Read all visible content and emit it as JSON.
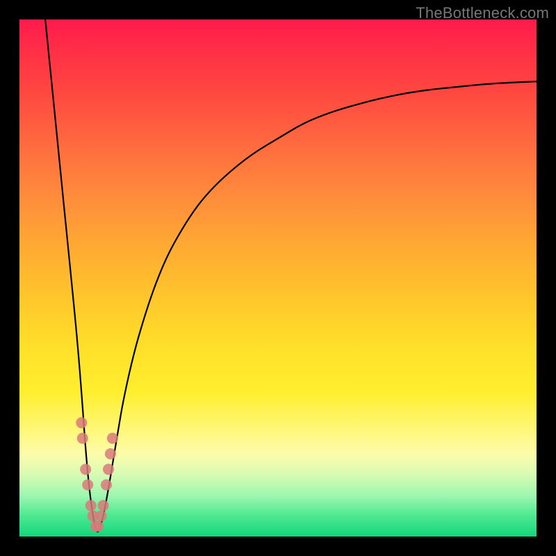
{
  "watermark": "TheBottleneck.com",
  "chart_data": {
    "type": "line",
    "title": "",
    "xlabel": "",
    "ylabel": "",
    "xlim": [
      0,
      100
    ],
    "ylim": [
      0,
      100
    ],
    "legend": false,
    "grid": false,
    "series": [
      {
        "name": "bottleneck-curve",
        "x": [
          5,
          6,
          7,
          8,
          9,
          10,
          11,
          12,
          13,
          14,
          15,
          16,
          17,
          18,
          19,
          20,
          22,
          24,
          26,
          28,
          30,
          33,
          36,
          40,
          45,
          50,
          55,
          60,
          65,
          70,
          75,
          80,
          85,
          90,
          95,
          100
        ],
        "values": [
          100,
          90,
          80,
          70,
          60,
          50,
          40,
          28,
          14,
          5,
          0,
          3,
          8,
          14,
          20,
          26,
          35,
          42,
          48,
          53,
          57,
          62,
          66,
          70,
          74,
          77,
          80,
          82,
          83.5,
          84.8,
          85.8,
          86.5,
          87,
          87.5,
          87.8,
          88
        ]
      }
    ],
    "markers": {
      "name": "highlight-markers",
      "points": [
        {
          "x": 12.0,
          "y": 22
        },
        {
          "x": 12.2,
          "y": 19
        },
        {
          "x": 12.8,
          "y": 13
        },
        {
          "x": 13.2,
          "y": 10
        },
        {
          "x": 13.8,
          "y": 6
        },
        {
          "x": 14.2,
          "y": 4
        },
        {
          "x": 14.8,
          "y": 2
        },
        {
          "x": 15.2,
          "y": 2
        },
        {
          "x": 15.8,
          "y": 4
        },
        {
          "x": 16.2,
          "y": 6
        },
        {
          "x": 16.8,
          "y": 10
        },
        {
          "x": 17.2,
          "y": 13
        },
        {
          "x": 17.6,
          "y": 16
        },
        {
          "x": 18.0,
          "y": 19
        }
      ],
      "radius": 8
    },
    "gradient_stops": [
      {
        "pos": 0,
        "color": "#ff1a4b"
      },
      {
        "pos": 50,
        "color": "#ffc72b"
      },
      {
        "pos": 78,
        "color": "#fef66a"
      },
      {
        "pos": 100,
        "color": "#12d77c"
      }
    ]
  }
}
